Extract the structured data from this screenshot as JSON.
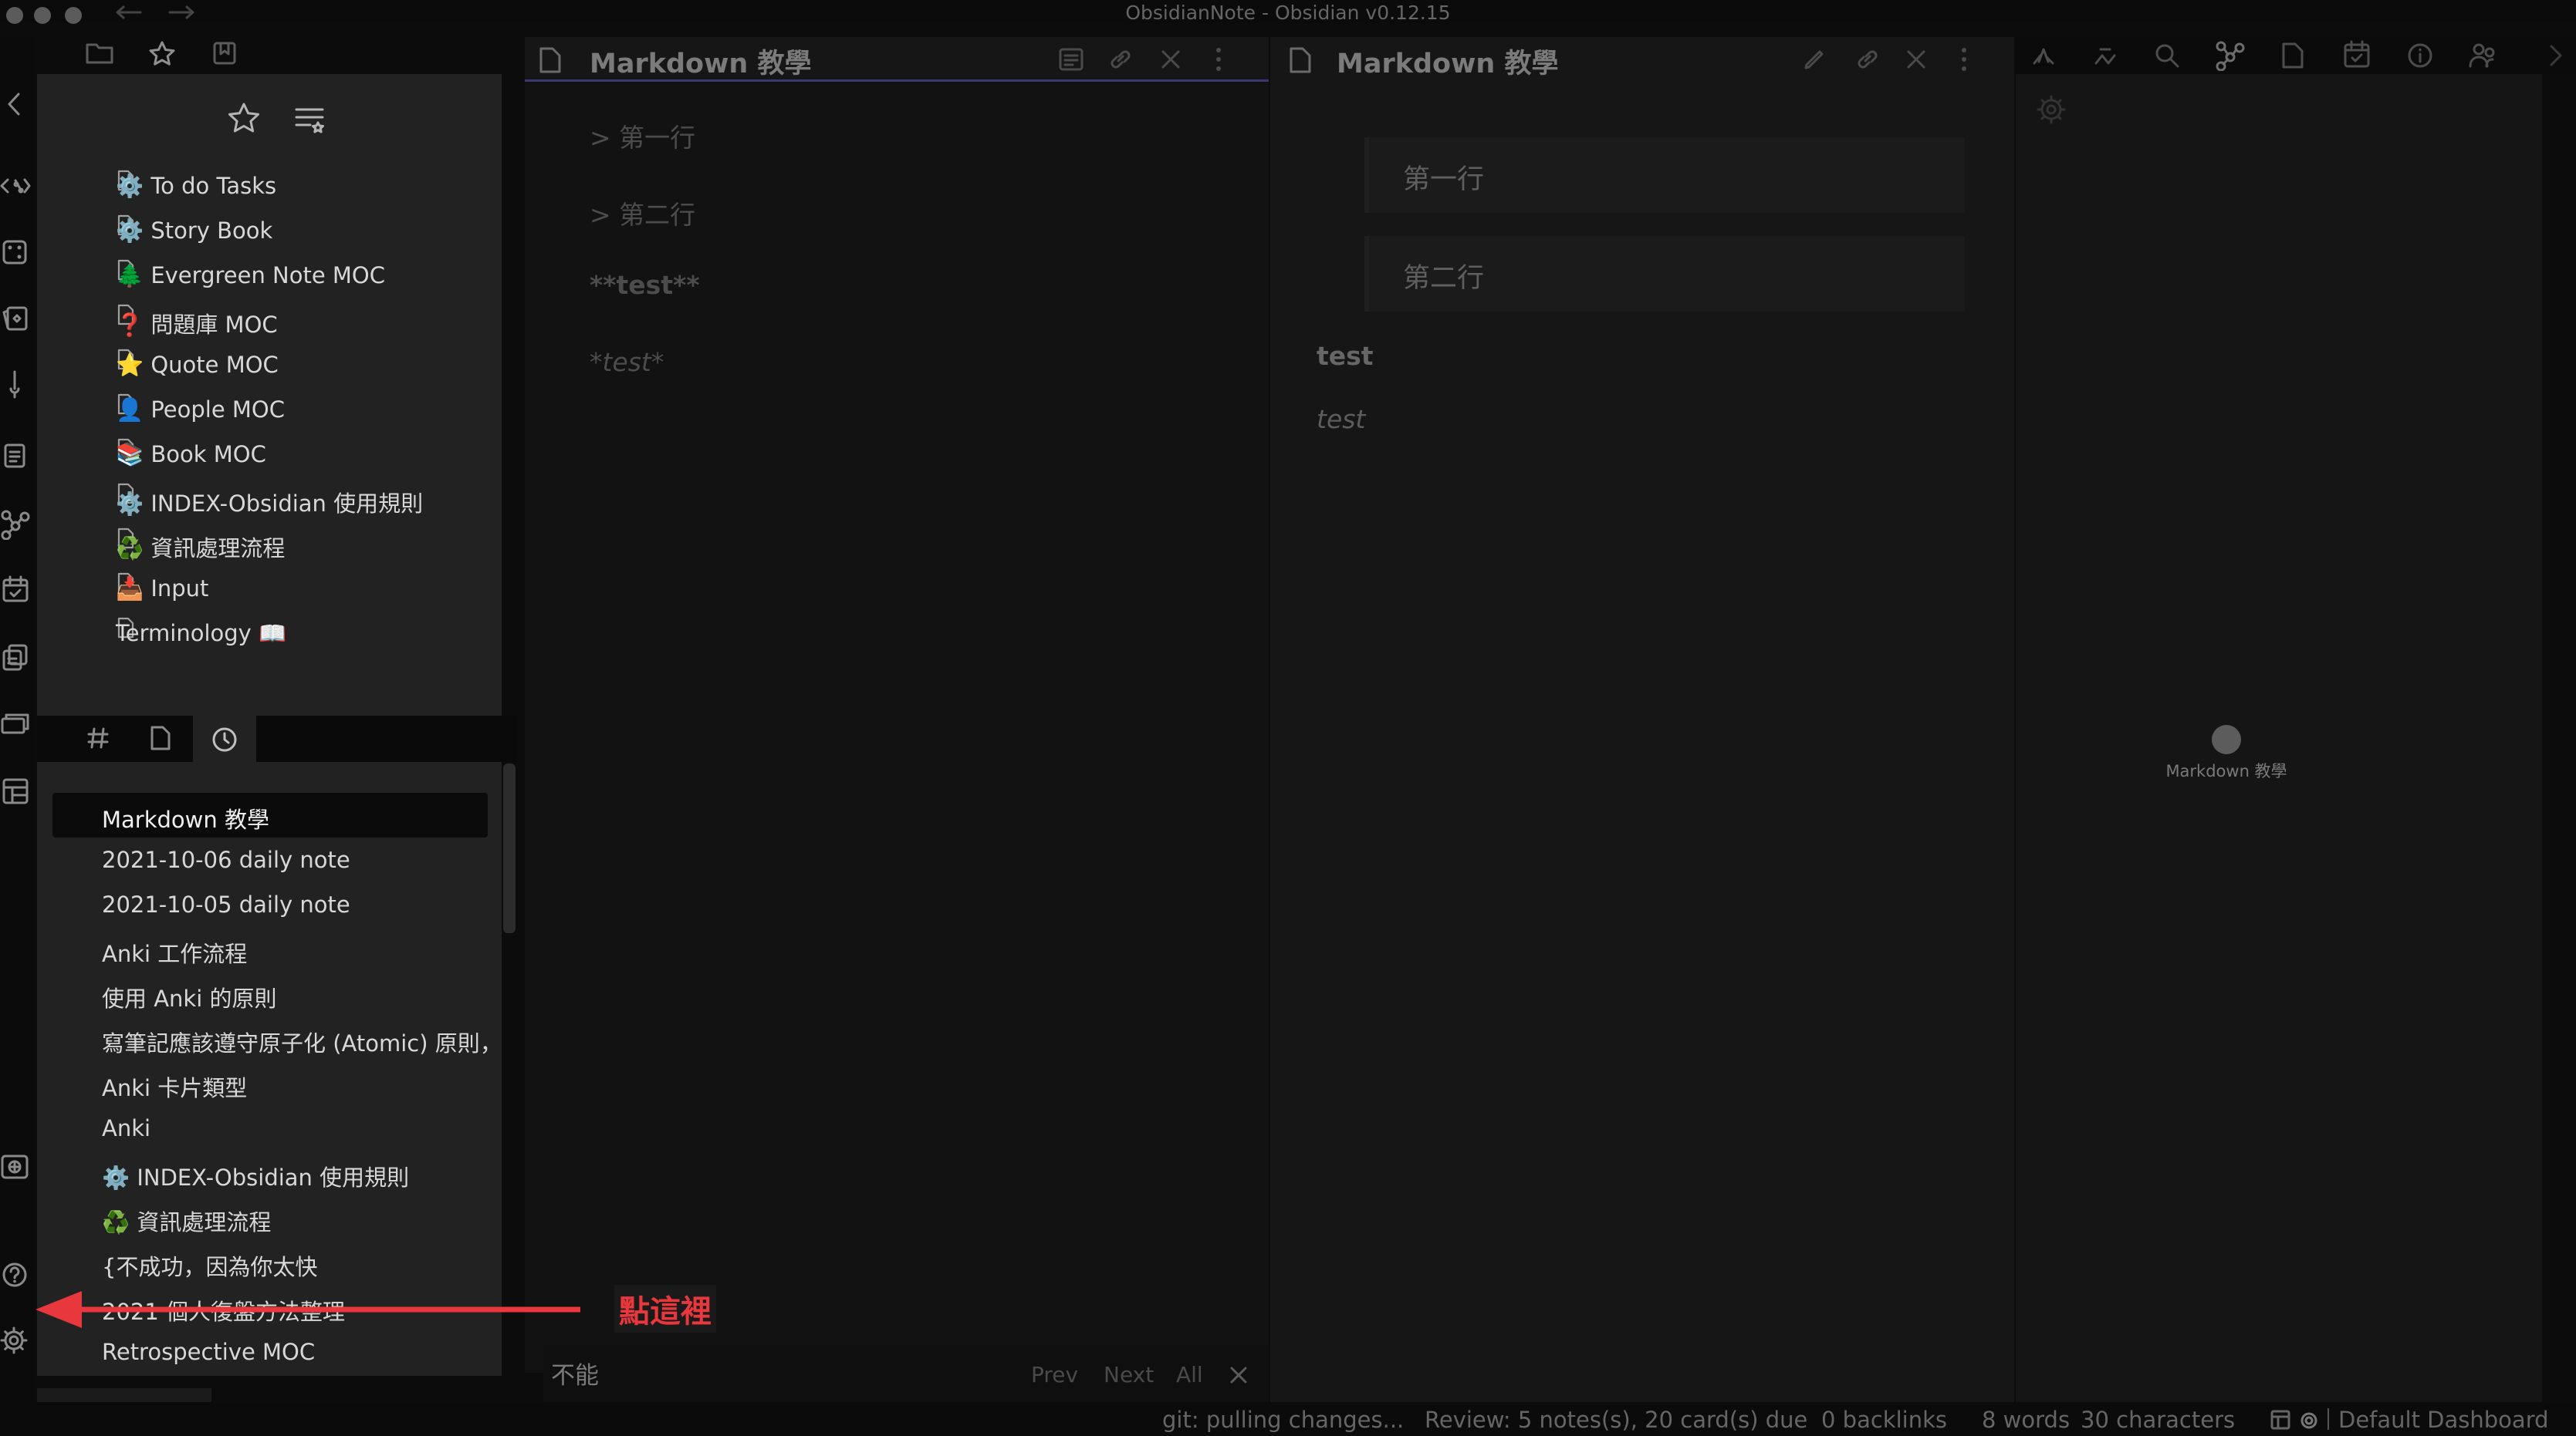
{
  "window": {
    "title": "ObsidianNote - Obsidian v0.12.15"
  },
  "favorites": [
    {
      "label": "⚙️ To do Tasks"
    },
    {
      "label": "⚙️ Story Book"
    },
    {
      "label": "🌲 Evergreen Note MOC"
    },
    {
      "label": "❓ 問題庫 MOC"
    },
    {
      "label": "⭐ Quote MOC"
    },
    {
      "label": "👤 People MOC"
    },
    {
      "label": "📚 Book MOC"
    },
    {
      "label": "⚙️ INDEX-Obsidian 使用規則"
    },
    {
      "label": "♻️ 資訊處理流程"
    },
    {
      "label": "📥 Input"
    },
    {
      "label": "Terminology 📖"
    }
  ],
  "recent": [
    {
      "label": "Markdown 教學",
      "active": true
    },
    {
      "label": "2021-10-06 daily note"
    },
    {
      "label": "2021-10-05 daily note"
    },
    {
      "label": "Anki 工作流程"
    },
    {
      "label": "使用 Anki 的原則"
    },
    {
      "label": "寫筆記應該遵守原子化 (Atomic) 原則，一"
    },
    {
      "label": "Anki 卡片類型"
    },
    {
      "label": "Anki"
    },
    {
      "label": "⚙️ INDEX-Obsidian 使用規則"
    },
    {
      "label": "♻️ 資訊處理流程"
    },
    {
      "label": "{不成功，因為你太快"
    },
    {
      "label": "2021 個人復盤方法整理"
    },
    {
      "label": "Retrospective MOC"
    }
  ],
  "editor": {
    "title": "Markdown 教學",
    "lines": [
      "> 第一行",
      "> 第二行",
      "**test**",
      "*test*"
    ],
    "search_value": "不能",
    "prev_label": "Prev",
    "next_label": "Next",
    "all_label": "All"
  },
  "preview": {
    "title": "Markdown 教學",
    "quote1": "第一行",
    "quote2": "第二行",
    "bold": "test",
    "italic": "test"
  },
  "graph": {
    "node_label": "Markdown 教學"
  },
  "annotation": {
    "text": "點這裡",
    "color": "#e8373d"
  },
  "status": {
    "git": "git: pulling changes...",
    "review": "Review: 5 notes(s), 20 card(s) due",
    "backlinks": "0 backlinks",
    "words": "8 words",
    "chars": "30 characters",
    "dashboard": "Default Dashboard"
  }
}
